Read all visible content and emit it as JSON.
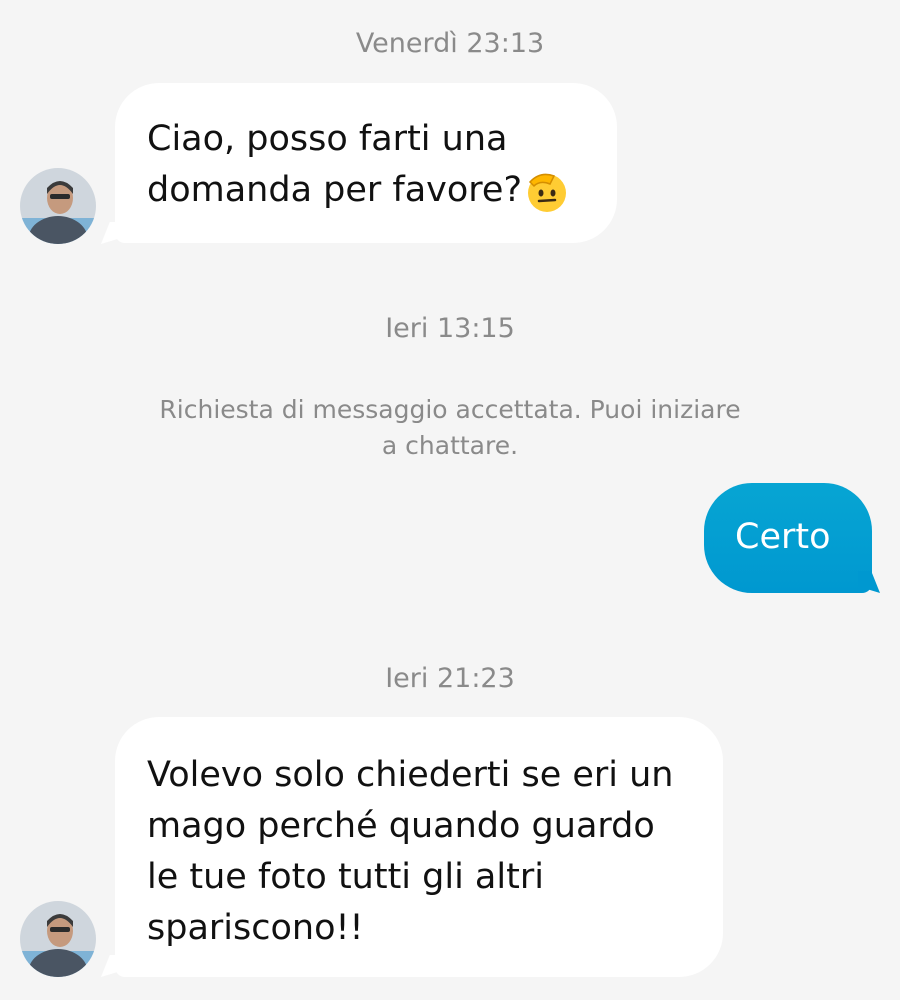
{
  "conversation": {
    "messages": [
      {
        "timestamp": "Venerdì 23:13"
      },
      {
        "sender": "them",
        "text": "Ciao, posso farti una domanda per favore?",
        "emoji": "saluting-face-icon"
      },
      {
        "timestamp": "Ieri 13:15"
      },
      {
        "system_note": "Richiesta di messaggio accettata. Puoi iniziare a chattare."
      },
      {
        "sender": "me",
        "text": "Certo"
      },
      {
        "timestamp": "Ieri 21:23"
      },
      {
        "sender": "them",
        "text": "Volevo solo chiederti se eri un mago perché quando guardo le tue foto tutti gli altri spariscono!!"
      }
    ]
  },
  "colors": {
    "background": "#f5f5f5",
    "incoming_bubble": "#ffffff",
    "outgoing_bubble": "#0098d0",
    "timestamp_text": "#8a8a8a"
  }
}
